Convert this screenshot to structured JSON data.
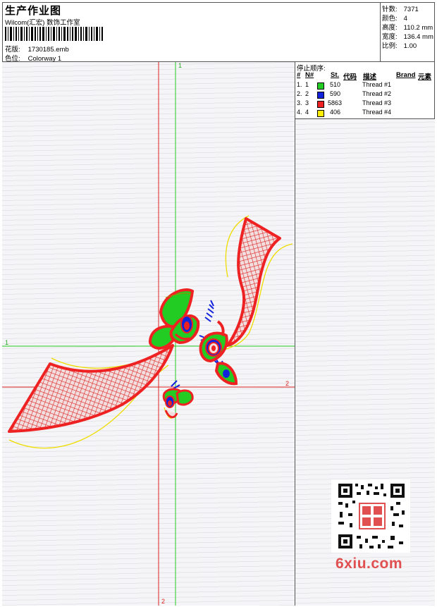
{
  "header": {
    "title": "生产作业图",
    "subtitle": "Wilcom(汇宏) 数饰工作室",
    "design_label": "花版:",
    "design_value": "1730185.emb",
    "colorway_label": "色位:",
    "colorway_value": "Colorway 1"
  },
  "stats": {
    "stitches_label": "针数:",
    "stitches_value": "7371",
    "colors_label": "颜色:",
    "colors_value": "4",
    "height_label": "高度:",
    "height_value": "110.2 mm",
    "width_label": "宽度:",
    "width_value": "136.4 mm",
    "scale_label": "比例:",
    "scale_value": "1.00"
  },
  "threads": {
    "title": "停止顺序:",
    "headers": {
      "num": "#",
      "n": "N#",
      "st": "St.",
      "code": "代码",
      "desc": "描述",
      "brand": "Brand",
      "element": "元素"
    },
    "rows": [
      {
        "num": "1.",
        "n": "1",
        "st": "510",
        "color": "#22cc22",
        "desc": "Thread #1"
      },
      {
        "num": "2.",
        "n": "2",
        "st": "590",
        "color": "#1122dd",
        "desc": "Thread #2"
      },
      {
        "num": "3.",
        "n": "3",
        "st": "5863",
        "color": "#ee2222",
        "desc": "Thread #3"
      },
      {
        "num": "4.",
        "n": "4",
        "st": "406",
        "color": "#ffee00",
        "desc": "Thread #4"
      }
    ]
  },
  "canvas": {
    "axis_green_v": "1",
    "axis_green_h": "1",
    "axis_red_h": "2",
    "axis_red_v": "2"
  },
  "watermark": "6xiu.com"
}
